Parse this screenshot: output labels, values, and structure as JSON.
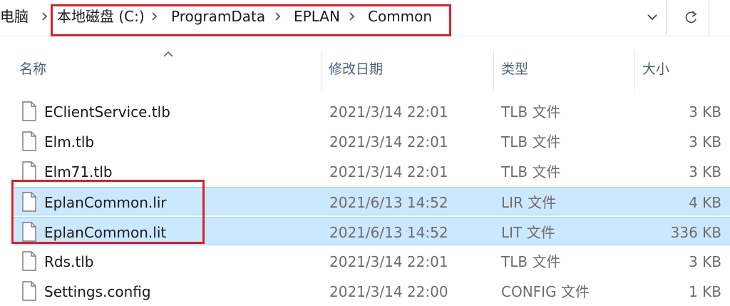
{
  "address": {
    "crumbs": [
      "电脑",
      "本地磁盘 (C:)",
      "ProgramData",
      "EPLAN",
      "Common"
    ]
  },
  "columns": {
    "name": "名称",
    "modified": "修改日期",
    "type": "类型",
    "size": "大小"
  },
  "files": [
    {
      "name": "EClientService.tlb",
      "modified": "2021/3/14 22:01",
      "type": "TLB 文件",
      "size": "3 KB"
    },
    {
      "name": "Elm.tlb",
      "modified": "2021/3/14 22:01",
      "type": "TLB 文件",
      "size": "3 KB"
    },
    {
      "name": "Elm71.tlb",
      "modified": "2021/3/14 22:01",
      "type": "TLB 文件",
      "size": "3 KB"
    },
    {
      "name": "EplanCommon.lir",
      "modified": "2021/6/13 14:52",
      "type": "LIR 文件",
      "size": "4 KB"
    },
    {
      "name": "EplanCommon.lit",
      "modified": "2021/6/13 14:52",
      "type": "LIT 文件",
      "size": "336 KB"
    },
    {
      "name": "Rds.tlb",
      "modified": "2021/3/14 22:01",
      "type": "TLB 文件",
      "size": "3 KB"
    },
    {
      "name": "Settings.config",
      "modified": "2021/3/14 22:00",
      "type": "CONFIG 文件",
      "size": "1 KB"
    }
  ],
  "colors": {
    "selection": "#cce8ff",
    "highlight": "#d6212b"
  }
}
